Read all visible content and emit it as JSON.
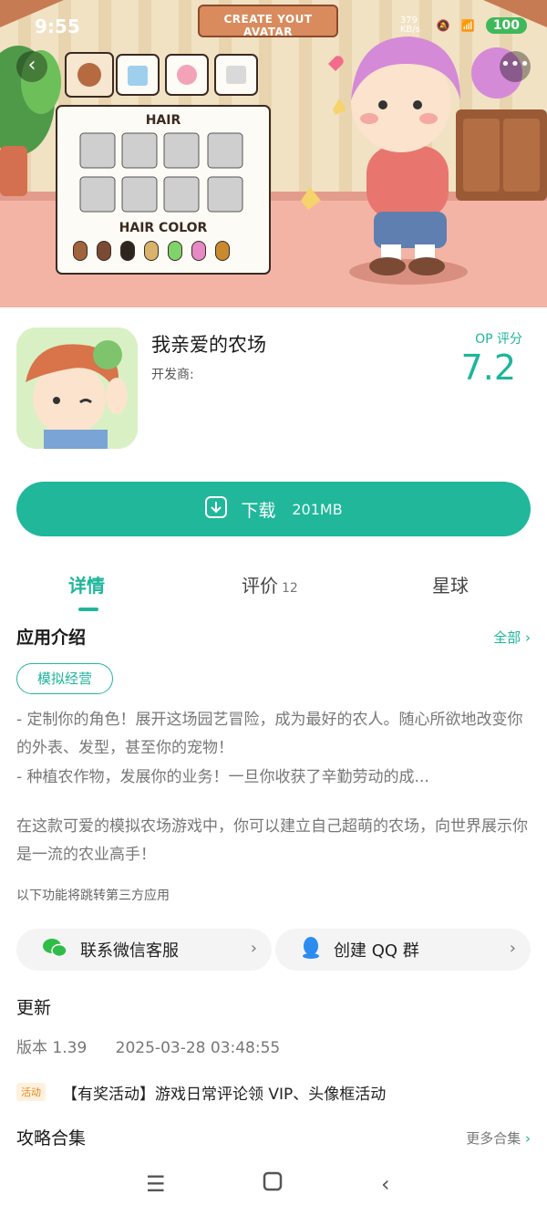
{
  "status_bar": {
    "time": "9:55",
    "net_speed": "379 KB/s",
    "battery": "100"
  },
  "banner": {
    "sign": "CREATE YOUT AVATAR",
    "hair_title": "HAIR",
    "hair_color_title": "HAIR COLOR",
    "swatch_colors": [
      "#a0643c",
      "#7a4a35",
      "#2f2520",
      "#d9b36a",
      "#7ed36a",
      "#e58ac4",
      "#c98a2f"
    ]
  },
  "app": {
    "name": "我亲爱的农场",
    "developer_label": "开发商:",
    "op_label": "OP 评分",
    "op_score": "7.2"
  },
  "download": {
    "label": "下载",
    "size": "201MB"
  },
  "tabs": [
    {
      "label": "详情"
    },
    {
      "label": "评价",
      "count": "12"
    },
    {
      "label": "星球"
    }
  ],
  "intro": {
    "title": "应用介绍",
    "all_link": "全部",
    "tag": "模拟经营",
    "line1": "- 定制你的角色！展开这场园艺冒险，成为最好的农人。随心所欲地改变你的外表、发型，甚至你的宠物！",
    "line2": "- 种植农作物，发展你的业务！一旦你收获了辛勤劳动的成...",
    "para2": "在这款可爱的模拟农场游戏中，你可以建立自己超萌的农场，向世界展示你是一流的农业高手！",
    "third_party_note": "以下功能将跳转第三方应用"
  },
  "third_party": {
    "wechat": "联系微信客服",
    "qq": "创建 QQ 群"
  },
  "update": {
    "title": "更新",
    "version": "版本 1.39",
    "date": "2025-03-28 03:48:55"
  },
  "activity": {
    "badge": "活动",
    "text": "【有奖活动】游戏日常评论领 VIP、头像框活动"
  },
  "guides": {
    "title": "攻略合集",
    "more": "更多合集"
  },
  "colors": {
    "accent": "#20b79b"
  }
}
